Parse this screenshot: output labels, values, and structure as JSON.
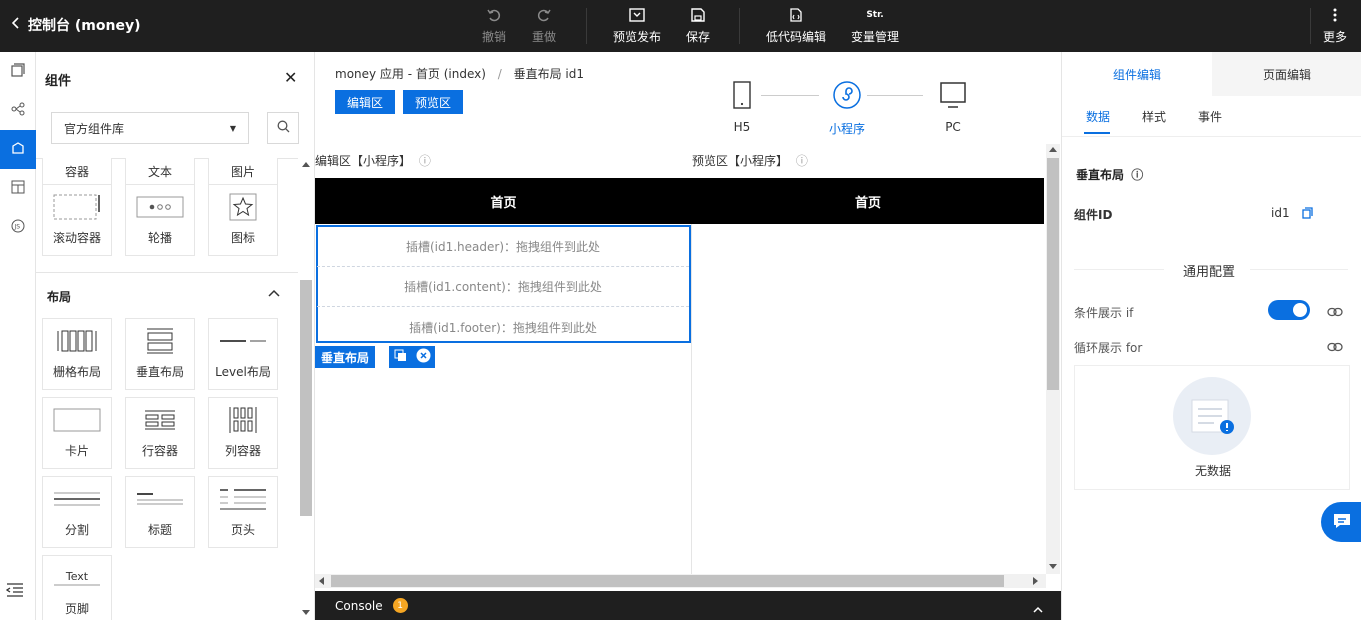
{
  "topbar": {
    "title": "控制台 (money)",
    "undo": "撤销",
    "redo": "重做",
    "preview_publish": "预览发布",
    "save": "保存",
    "lowcode_edit": "低代码编辑",
    "var_icon_text": "Str.",
    "var_manage": "变量管理",
    "more": "更多"
  },
  "left": {
    "title": "组件",
    "library_select": "官方组件库",
    "partial_row": [
      "容器",
      "文本",
      "图片"
    ],
    "basic_row": [
      "滚动容器",
      "轮播",
      "图标"
    ],
    "layout_section": "布局",
    "layout_items": [
      "栅格布局",
      "垂直布局",
      "Level布局",
      "卡片",
      "行容器",
      "列容器",
      "分割",
      "标题",
      "页头",
      "页脚"
    ],
    "footer_icon_text": "Text"
  },
  "center": {
    "breadcrumb_app": "money 应用 - 首页 (index)",
    "breadcrumb_sep": "/",
    "breadcrumb_current": "垂直布局 id1",
    "edit_btn": "编辑区",
    "preview_btn": "预览区",
    "devices": [
      "H5",
      "小程序",
      "PC"
    ],
    "active_device": "小程序",
    "edit_zone_label": "编辑区【小程序】",
    "preview_zone_label": "预览区【小程序】",
    "page_title": "首页",
    "slots": [
      "插槽(id1.header)：拖拽组件到此处",
      "插槽(id1.content)：拖拽组件到此处",
      "插槽(id1.footer)：拖拽组件到此处"
    ],
    "selected_component": "垂直布局",
    "console_label": "Console",
    "console_count": "1"
  },
  "right": {
    "tabs": [
      "组件编辑",
      "页面编辑"
    ],
    "subtabs": [
      "数据",
      "样式",
      "事件"
    ],
    "component_name": "垂直布局",
    "id_label": "组件ID",
    "id_value": "id1",
    "general_config": "通用配置",
    "cond_label": "条件展示 if",
    "loop_label": "循环展示 for",
    "empty_text": "无数据"
  },
  "colors": {
    "accent": "#0a6fe0",
    "topbar_bg": "#1f1f1f",
    "phone_header_bg": "#000000",
    "console_bg": "#1f1f1f",
    "badge": "#f5a623"
  }
}
